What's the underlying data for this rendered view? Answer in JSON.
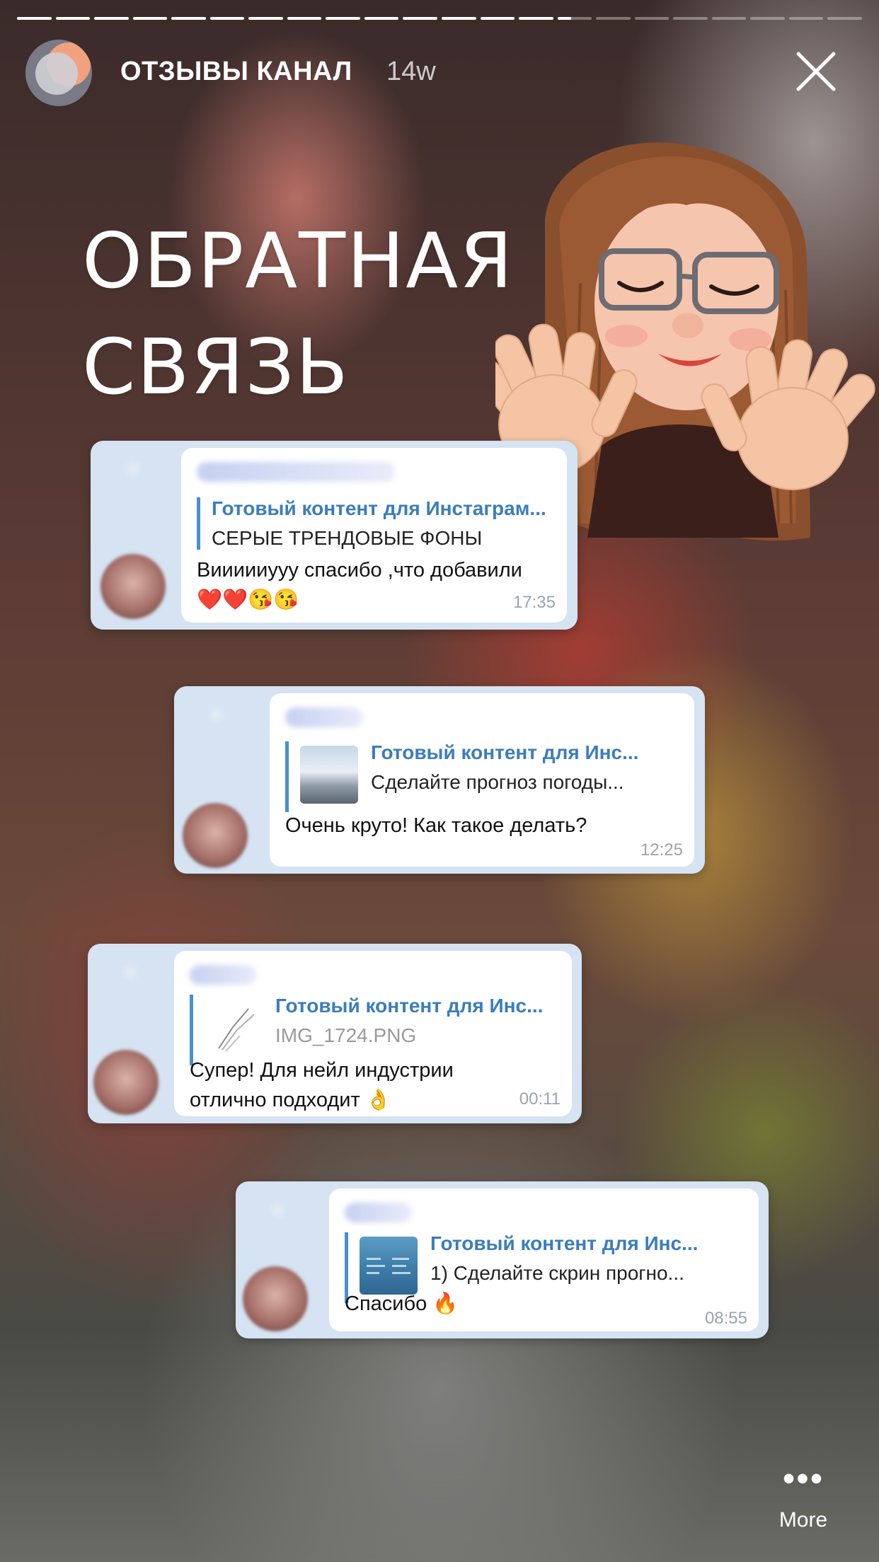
{
  "story": {
    "segment_count": 22,
    "active_segment_index": 14
  },
  "header": {
    "channel_name": "ОТЗЫВЫ КАНАЛ",
    "time_ago": "14w",
    "close_icon": "close-icon"
  },
  "title": {
    "line1": "ОБРАТНАЯ",
    "line2": "СВЯЗЬ"
  },
  "messages": [
    {
      "reply_title": "Готовый контент для Инстаграм...",
      "reply_subtitle": "СЕРЫЕ ТРЕНДОВЫЕ ФОНЫ",
      "message_line1": "Виииииууу спасибо ,что добавили",
      "message_emoji": "❤️❤️😘😘",
      "time": "17:35"
    },
    {
      "reply_title": "Готовый контент для Инс...",
      "reply_subtitle": "Сделайте прогноз погоды...",
      "message_line1": "Очень круто! Как такое делать?",
      "time": "12:25"
    },
    {
      "reply_title": "Готовый контент для Инс...",
      "reply_subtitle": "IMG_1724.PNG",
      "message_line1": "Супер! Для нейл индустрии",
      "message_line2": "отлично подходит 👌",
      "time": "00:11"
    },
    {
      "reply_title": "Готовый контент для Инс...",
      "reply_subtitle": "1) Сделайте скрин прогно...",
      "message_line1": "Спасибо 🔥",
      "time": "08:55"
    }
  ],
  "footer": {
    "more_dots": "•••",
    "more_label": "More"
  },
  "colors": {
    "reply_accent": "#3b7dbd",
    "card_bg": "#d5e3f2"
  }
}
